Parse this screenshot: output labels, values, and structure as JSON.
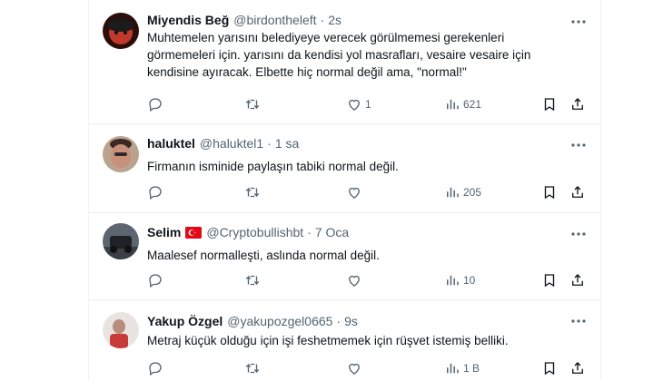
{
  "tweets": [
    {
      "name": "Miyendis Beğ",
      "handle": "@birdontheleft",
      "time": "2s",
      "text": "Muhtemelen yarısını belediyeye verecek görülmemesi gerekenleri görmemeleri için. yarısını da kendisi yol masrafları, vesaire vesaire için kendisine ayıracak. Elbette hiç normal değil ama, \"normal!\"",
      "likes": "1",
      "views": "621",
      "flag": ""
    },
    {
      "name": "haluktel",
      "handle": "@haluktel1",
      "time": "1 sa",
      "text": "Firmanın isminide paylaşın tabiki normal değil.",
      "likes": "",
      "views": "205",
      "flag": ""
    },
    {
      "name": "Selim",
      "handle": "@Cryptobullishbt",
      "time": "7 Oca",
      "text": "Maalesef normalleşti, aslında normal değil.",
      "likes": "",
      "views": "10",
      "flag": "tr-flag"
    },
    {
      "name": "Yakup Özgel",
      "handle": "@yakupozgel0665",
      "time": "9s",
      "text": "Metraj küçük olduğu için işi feshetmemek için rüşvet istemiş belliki.",
      "likes": "",
      "views": "1 B",
      "flag": ""
    }
  ],
  "icons": {
    "reply": "reply-icon",
    "retweet": "retweet-icon",
    "like": "heart-icon",
    "views": "views-chart-icon",
    "bookmark": "bookmark-icon",
    "share": "share-icon",
    "more": "more-dots-icon"
  },
  "colors": {
    "text": "#0f1419",
    "secondary": "#536471",
    "border": "#e7ecef",
    "flag_red": "#e30a17"
  }
}
